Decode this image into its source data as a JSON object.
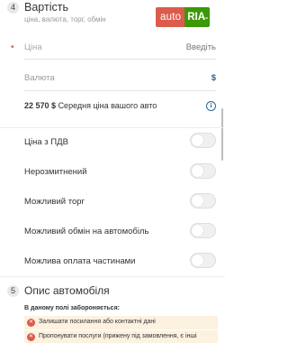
{
  "section4": {
    "step": "4",
    "title": "Вартість",
    "subtitle": "ціна, валюта, торг, обмін"
  },
  "logo": {
    "left": "auto",
    "right": "RIA",
    "domain": ".ua"
  },
  "price": {
    "placeholder": "Ціна",
    "action": "Введіть",
    "required_mark": "•"
  },
  "currency": {
    "label": "Валюта",
    "value": "$"
  },
  "average": {
    "amount": "22 570 $",
    "text": "Середня ціна вашого авто",
    "info_icon": "info-icon"
  },
  "options": [
    {
      "label": "Ціна з ПДВ",
      "on": false
    },
    {
      "label": "Нерозмитнений",
      "on": false
    },
    {
      "label": "Можливий торг",
      "on": false
    },
    {
      "label": "Можливий обмін на автомобіль",
      "on": false
    },
    {
      "label": "Можлива оплата частинами",
      "on": false
    }
  ],
  "section5": {
    "step": "5",
    "title": "Опис автомобіля",
    "forbidden_title": "В даному полі забороняється:",
    "forbidden": [
      "Залишати посилання або контактні дані",
      "Пропонувати послуги (прижену під замовлення, є інші"
    ]
  },
  "colors": {
    "accent_red": "#db5c4c",
    "brand_green": "#3c9806",
    "link_blue": "#256799",
    "warn_bg": "#fdf1df"
  }
}
